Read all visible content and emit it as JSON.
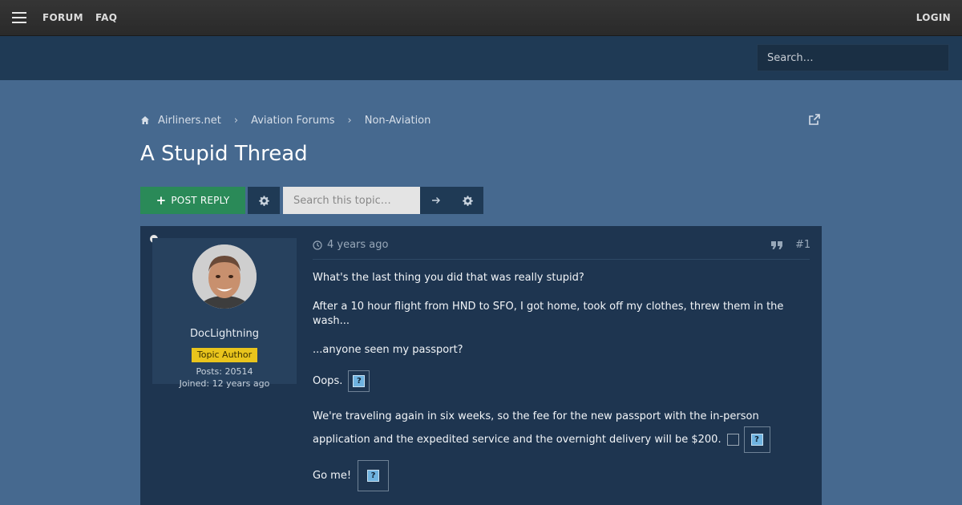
{
  "topnav": {
    "forum": "FORUM",
    "faq": "FAQ",
    "login": "LOGIN"
  },
  "header": {
    "search_placeholder": "Search…"
  },
  "breadcrumb": {
    "items": [
      "Airliners.net",
      "Aviation Forums",
      "Non-Aviation"
    ]
  },
  "page_title": "A Stupid Thread",
  "actions": {
    "post_reply": "POST REPLY",
    "topic_search_placeholder": "Search this topic…"
  },
  "post": {
    "author": "DocLightning",
    "badge": "Topic Author",
    "posts": "Posts: 20514",
    "joined": "Joined: 12 years ago",
    "time": "4 years ago",
    "number": "#1",
    "paragraphs": [
      "What's the last thing you did that was really stupid?",
      "After a 10 hour flight from HND to SFO, I got home, took off my clothes, threw them in the wash...",
      "...anyone seen my passport?",
      "Oops.",
      "We're traveling again in six weeks, so the fee for the new passport with the in-person application and the expedited service and the overnight delivery will be $200.",
      "Go me!"
    ]
  },
  "colors": {
    "page_bg": "#46698f",
    "header_band": "#1f3a55",
    "reply_button": "#2a8a58",
    "badge": "#e9c41c"
  }
}
